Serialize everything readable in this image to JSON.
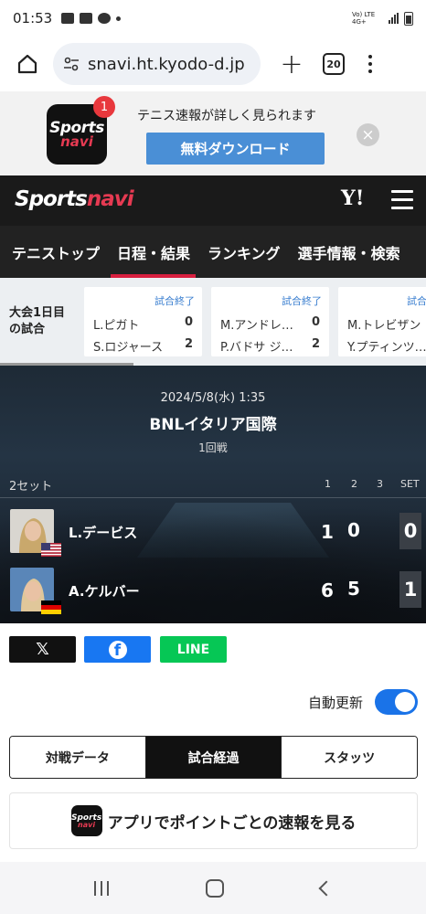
{
  "status_bar": {
    "time": "01:53",
    "network": "Vo) LTE 4G+"
  },
  "browser": {
    "url": "snavi.ht.kyodo-d.jp",
    "tab_count": "20"
  },
  "app_banner": {
    "badge": "1",
    "text": "テニス速報が詳しく見られます",
    "download_label": "無料ダウンロード",
    "close_glyph": "×",
    "logo_top": "Sports",
    "logo_bottom": "navi"
  },
  "site_header": {
    "brand_left": "Sports",
    "brand_right": "navi",
    "yahoo": "Y!"
  },
  "nav_tabs": [
    {
      "label": "テニストップ",
      "active": false
    },
    {
      "label": "日程・結果",
      "active": true
    },
    {
      "label": "ランキング",
      "active": false
    },
    {
      "label": "選手情報・検索",
      "active": false
    }
  ],
  "tournament_strip": {
    "label_line1": "大会1日目",
    "label_line2": "の試合",
    "matches": [
      {
        "status": "試合終了",
        "p1": "L.ピガト",
        "s1": "0",
        "p2": "S.ロジャース",
        "s2": "2"
      },
      {
        "status": "試合終了",
        "p1": "M.アンドレ…",
        "s1": "0",
        "p2": "P.バドサ ジ…",
        "s2": "2"
      },
      {
        "status": "試合",
        "p1": "M.トレビザン",
        "s1": "",
        "p2": "Y.プティンツ…",
        "s2": ""
      }
    ]
  },
  "scoreboard": {
    "date": "2024/5/8(水) 1:35",
    "title": "BNLイタリア国際",
    "round": "1回戦",
    "format": "2セット",
    "col1": "1",
    "col2": "2",
    "col3": "3",
    "col_set": "SET",
    "players": [
      {
        "name": "L.デービス",
        "set1": "1",
        "set2": "0",
        "sets_won": "0",
        "flag": "USA"
      },
      {
        "name": "A.ケルバー",
        "set1": "6",
        "set2": "5",
        "sets_won": "1",
        "flag": "GER"
      }
    ]
  },
  "share": {
    "x": "𝕏",
    "facebook": "f",
    "line": "LINE"
  },
  "auto_update": {
    "label": "自動更新",
    "enabled": true
  },
  "segment": {
    "items": [
      "対戦データ",
      "試合経過",
      "スタッツ"
    ],
    "active_index": 1
  },
  "app_cta": {
    "text": "アプリでポイントごとの速報を見る",
    "logo_top": "Sports",
    "logo_bottom": "navi"
  },
  "colors": {
    "accent_red": "#d81f3f",
    "link_blue": "#3b7fd0",
    "toggle_blue": "#1a73e8",
    "facebook": "#1877f2",
    "line": "#06c755"
  }
}
